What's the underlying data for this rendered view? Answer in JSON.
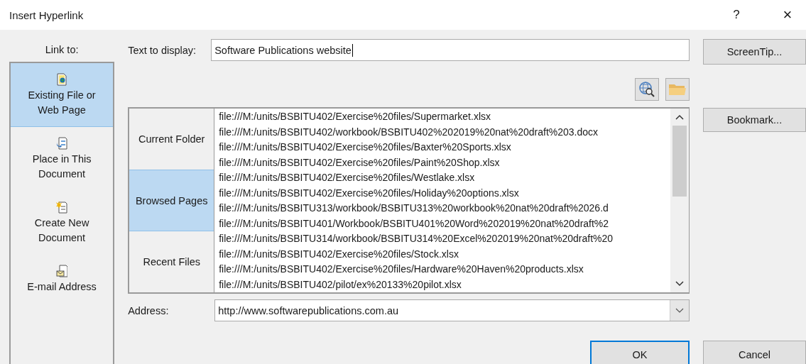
{
  "window": {
    "title": "Insert Hyperlink",
    "help": "?",
    "close": "×"
  },
  "link_to": {
    "label": "Link to:",
    "items": [
      {
        "kind": "file",
        "label": "Existing File or Web Page",
        "selected": true
      },
      {
        "kind": "place",
        "label": "Place in This Document",
        "selected": false
      },
      {
        "kind": "new",
        "label": "Create New Document",
        "selected": false
      },
      {
        "kind": "email",
        "label": "E-mail Address",
        "selected": false
      }
    ]
  },
  "text_to_display": {
    "label": "Text to display:",
    "value": "Software Publications website"
  },
  "look_in_tabs": [
    {
      "label": "Current Folder",
      "selected": false
    },
    {
      "label": "Browsed Pages",
      "selected": true
    },
    {
      "label": "Recent Files",
      "selected": false
    }
  ],
  "files": [
    "file:///M:/units/BSBITU402/Exercise%20files/Supermarket.xlsx",
    "file:///M:/units/BSBITU402/workbook/BSBITU402%202019%20nat%20draft%203.docx",
    "file:///M:/units/BSBITU402/Exercise%20files/Baxter%20Sports.xlsx",
    "file:///M:/units/BSBITU402/Exercise%20files/Paint%20Shop.xlsx",
    "file:///M:/units/BSBITU402/Exercise%20files/Westlake.xlsx",
    "file:///M:/units/BSBITU402/Exercise%20files/Holiday%20options.xlsx",
    "file:///M:/units/BSBITU313/workbook/BSBITU313%20workbook%20nat%20draft%2026.d",
    "file:///M:/units/BSBITU401/Workbook/BSBITU401%20Word%202019%20nat%20draft%2",
    "file:///M:/units/BSBITU314/workbook/BSBITU314%20Excel%202019%20nat%20draft%20",
    "file:///M:/units/BSBITU402/Exercise%20files/Stock.xlsx",
    "file:///M:/units/BSBITU402/Exercise%20files/Hardware%20Haven%20products.xlsx",
    "file:///M:/units/BSBITU402/pilot/ex%20133%20pilot.xlsx"
  ],
  "address": {
    "label": "Address:",
    "value": "http://www.softwarepublications.com.au"
  },
  "buttons": {
    "screentip": "ScreenTip...",
    "bookmark": "Bookmark...",
    "ok": "OK",
    "cancel": "Cancel"
  }
}
